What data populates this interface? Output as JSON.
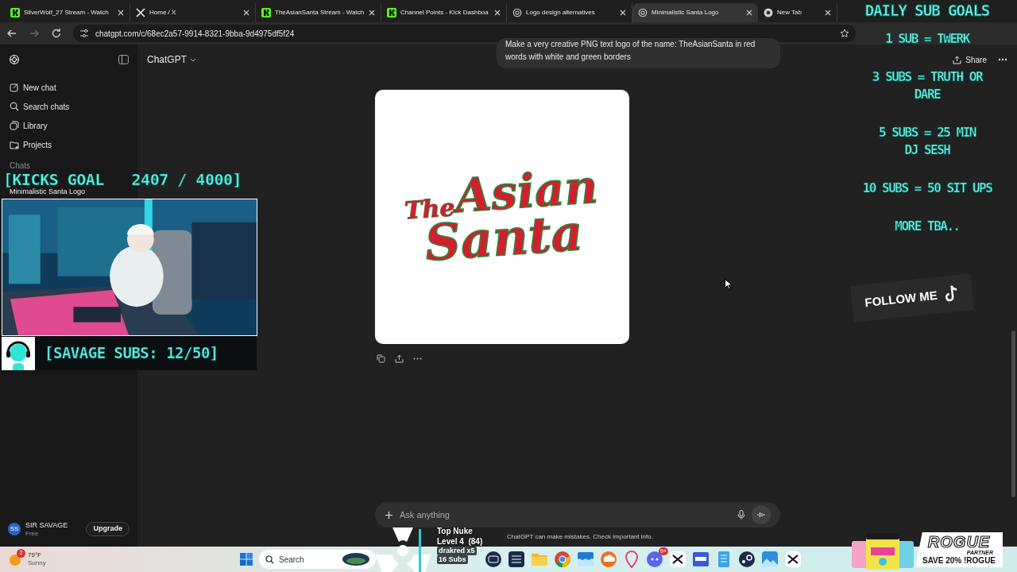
{
  "browser": {
    "tabs": [
      {
        "title": "SilverWolf_27 Stream - Watch",
        "kind": "kick",
        "selected": false
      },
      {
        "title": "Home / X",
        "kind": "x",
        "selected": false
      },
      {
        "title": "TheAsianSanta Stream - Watch",
        "kind": "kick",
        "selected": false
      },
      {
        "title": "Channel Points - Kick Dashboa",
        "kind": "kick",
        "selected": false
      },
      {
        "title": "Logo design alternatives",
        "kind": "chatgpt",
        "selected": false
      },
      {
        "title": "Minimalistic Santa Logo",
        "kind": "chatgpt",
        "selected": true
      },
      {
        "title": "New Tab",
        "kind": "chrome",
        "selected": false
      }
    ],
    "url": "chatgpt.com/c/68ec2a57-9914-8321-9bba-9d4975df5f24"
  },
  "sidebar": {
    "items": [
      {
        "label": "New chat",
        "kind": "new"
      },
      {
        "label": "Search chats",
        "kind": "search"
      },
      {
        "label": "Library",
        "kind": "library"
      },
      {
        "label": "Projects",
        "kind": "projects"
      }
    ],
    "section": "Chats",
    "chats": [
      {
        "title": "Minimalistic Santa Logo"
      }
    ],
    "user": {
      "initials": "SS",
      "name": "SIR SAVAGE",
      "plan": "Free"
    },
    "upgrade": "Upgrade"
  },
  "chat": {
    "model": "ChatGPT",
    "share": "Share",
    "user_message": [
      "Make a very creative PNG text logo of the name: TheAsianSanta in red",
      "words with white and green borders"
    ],
    "image_text": [
      "The",
      "Asian",
      "Santa"
    ],
    "composer_placeholder": "Ask anything",
    "disclaimer": "ChatGPT can make mistakes. Check important info."
  },
  "overlays": {
    "kicks_goal": "[KICKS GOAL   2407 / 4000]",
    "subs_goal": "[SAVAGE SUBS: 12/50]",
    "goals_title": "DAILY SUB GOALS",
    "goals": [
      [
        "1 SUB = TWERK"
      ],
      [
        "3 SUBS = TRUTH OR",
        "DARE"
      ],
      [
        "5 SUBS = 25 MIN",
        "DJ SESH"
      ],
      [
        "10 SUBS = 50 SIT UPS"
      ],
      [
        "MORE TBA.."
      ]
    ],
    "follow": "FOLLOW ME",
    "nuke": {
      "title": "Top Nuke",
      "rank": "Level 4  (84)",
      "user": "drakred x5",
      "subs": "16 Subs"
    },
    "ad": {
      "brand": "ROGUE",
      "tag": "PARTNER",
      "offer": "SAVE 20% !ROGUE"
    }
  },
  "taskbar": {
    "weather": {
      "temp": "79°F",
      "condition": "Sunny",
      "badge": "2"
    },
    "search": "Search",
    "apps": [
      {
        "kind": "camera"
      },
      {
        "kind": "grid"
      },
      {
        "kind": "folder"
      },
      {
        "kind": "chrome"
      },
      {
        "kind": "waves"
      },
      {
        "kind": "cloud"
      },
      {
        "kind": "pin"
      },
      {
        "kind": "discord",
        "badge": "9+"
      },
      {
        "kind": "capcut"
      },
      {
        "kind": "mdd"
      },
      {
        "kind": "notepad"
      },
      {
        "kind": "steam"
      },
      {
        "kind": "photos"
      },
      {
        "kind": "capcut"
      }
    ]
  }
}
